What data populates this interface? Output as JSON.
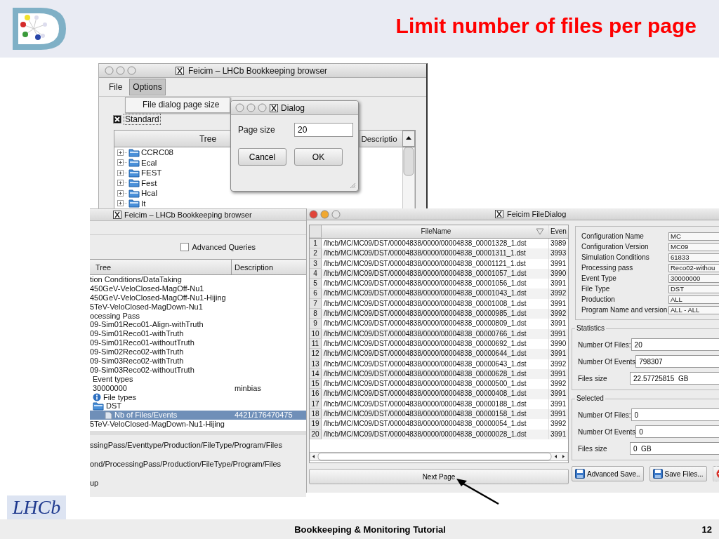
{
  "slide": {
    "title": "Limit number of files per page",
    "footer": "Bookkeeping & Monitoring Tutorial",
    "page_number": "12",
    "logo_text": "LHCb"
  },
  "browser": {
    "title": "Feicim – LHCb Bookkeeping browser",
    "menus": [
      {
        "label": "File",
        "selected": false
      },
      {
        "label": "Options",
        "selected": true
      }
    ],
    "menu_items": [
      "File dialog page size"
    ],
    "standard": {
      "label": "Standard",
      "checked": true
    },
    "columns": [
      "Tree",
      "Descriptio"
    ],
    "tree": [
      {
        "label": "CCRC08",
        "expanded": false
      },
      {
        "label": "Ecal",
        "expanded": false
      },
      {
        "label": "FEST",
        "expanded": false
      },
      {
        "label": "Fest",
        "expanded": false
      },
      {
        "label": "Hcal",
        "expanded": false
      },
      {
        "label": "It",
        "expanded": false
      }
    ]
  },
  "dialog": {
    "title": "Dialog",
    "field_label": "Page size",
    "field_value": "20",
    "buttons": [
      "Cancel",
      "OK"
    ]
  },
  "browser_back": {
    "title": "Feicim – LHCb Bookkeeping browser",
    "advanced_queries": {
      "label": "Advanced Queries",
      "checked": false
    },
    "columns": [
      "Tree",
      "Description"
    ],
    "rows": [
      {
        "label": "tion Conditions/DataTaking",
        "kind": "text",
        "selected": false
      },
      {
        "label": "450GeV-VeloClosed-MagOff-Nu1",
        "kind": "text",
        "selected": false
      },
      {
        "label": "450GeV-VeloClosed-MagOff-Nu1-Hijing",
        "kind": "text",
        "selected": false
      },
      {
        "label": "5TeV-VeloClosed-MagDown-Nu1",
        "kind": "text",
        "selected": false
      },
      {
        "label": "ocessing Pass",
        "kind": "text",
        "selected": false
      },
      {
        "label": "09-Sim01Reco01-Align-withTruth",
        "kind": "text",
        "selected": false
      },
      {
        "label": "09-Sim01Reco01-withTruth",
        "kind": "text",
        "selected": false
      },
      {
        "label": "09-Sim01Reco01-withoutTruth",
        "kind": "text",
        "selected": false
      },
      {
        "label": "09-Sim02Reco02-withTruth",
        "kind": "text",
        "selected": false
      },
      {
        "label": "09-Sim03Reco02-withTruth",
        "kind": "text",
        "selected": false
      },
      {
        "label": "09-Sim03Reco02-withoutTruth",
        "kind": "text",
        "selected": false
      },
      {
        "label": "Event types",
        "kind": "sub",
        "selected": false
      },
      {
        "label": "30000000",
        "description": "minbias",
        "kind": "sub",
        "selected": false
      },
      {
        "label": "File types",
        "kind": "info",
        "selected": false
      },
      {
        "label": "DST",
        "kind": "folder",
        "selected": false
      },
      {
        "label": "Nb of Files/Events",
        "description": "4421/176470475",
        "kind": "file",
        "selected": true
      },
      {
        "label": "5TeV-VeloClosed-MagDown-Nu1-Hijing",
        "kind": "text",
        "selected": false
      }
    ],
    "paths": [
      "ssingPass/Eventtype/Production/FileType/Program/Files",
      "ond/ProcessingPass/Production/FileType/Program/Files",
      "up"
    ]
  },
  "file_dialog": {
    "title": "Feicim FileDialog",
    "columns": [
      "FileName",
      "Even"
    ],
    "rows": [
      {
        "number": "1",
        "file": "/lhcb/MC/MC09/DST/00004838/0000/00004838_00001328_1.dst",
        "events": "3989"
      },
      {
        "number": "2",
        "file": "/lhcb/MC/MC09/DST/00004838/0000/00004838_00001311_1.dst",
        "events": "3993"
      },
      {
        "number": "3",
        "file": "/lhcb/MC/MC09/DST/00004838/0000/00004838_00001121_1.dst",
        "events": "3991"
      },
      {
        "number": "4",
        "file": "/lhcb/MC/MC09/DST/00004838/0000/00004838_00001057_1.dst",
        "events": "3990"
      },
      {
        "number": "5",
        "file": "/lhcb/MC/MC09/DST/00004838/0000/00004838_00001056_1.dst",
        "events": "3991"
      },
      {
        "number": "6",
        "file": "/lhcb/MC/MC09/DST/00004838/0000/00004838_00001043_1.dst",
        "events": "3992"
      },
      {
        "number": "7",
        "file": "/lhcb/MC/MC09/DST/00004838/0000/00004838_00001008_1.dst",
        "events": "3991"
      },
      {
        "number": "8",
        "file": "/lhcb/MC/MC09/DST/00004838/0000/00004838_00000985_1.dst",
        "events": "3992"
      },
      {
        "number": "9",
        "file": "/lhcb/MC/MC09/DST/00004838/0000/00004838_00000809_1.dst",
        "events": "3991"
      },
      {
        "number": "10",
        "file": "/lhcb/MC/MC09/DST/00004838/0000/00004838_00000766_1.dst",
        "events": "3991"
      },
      {
        "number": "11",
        "file": "/lhcb/MC/MC09/DST/00004838/0000/00004838_00000692_1.dst",
        "events": "3990"
      },
      {
        "number": "12",
        "file": "/lhcb/MC/MC09/DST/00004838/0000/00004838_00000644_1.dst",
        "events": "3991"
      },
      {
        "number": "13",
        "file": "/lhcb/MC/MC09/DST/00004838/0000/00004838_00000643_1.dst",
        "events": "3992"
      },
      {
        "number": "14",
        "file": "/lhcb/MC/MC09/DST/00004838/0000/00004838_00000628_1.dst",
        "events": "3991"
      },
      {
        "number": "15",
        "file": "/lhcb/MC/MC09/DST/00004838/0000/00004838_00000500_1.dst",
        "events": "3992"
      },
      {
        "number": "16",
        "file": "/lhcb/MC/MC09/DST/00004838/0000/00004838_00000408_1.dst",
        "events": "3991"
      },
      {
        "number": "17",
        "file": "/lhcb/MC/MC09/DST/00004838/0000/00004838_00000188_1.dst",
        "events": "3991"
      },
      {
        "number": "18",
        "file": "/lhcb/MC/MC09/DST/00004838/0000/00004838_00000158_1.dst",
        "events": "3991"
      },
      {
        "number": "19",
        "file": "/lhcb/MC/MC09/DST/00004838/0000/00004838_00000054_1.dst",
        "events": "3992"
      },
      {
        "number": "20",
        "file": "/lhcb/MC/MC09/DST/00004838/0000/00004838_00000028_1.dst",
        "events": "3991"
      }
    ],
    "next_button": "Next Page",
    "config": [
      {
        "label": "Configuration Name",
        "value": "MC"
      },
      {
        "label": "Configuration Version",
        "value": "MC09"
      },
      {
        "label": "Simulation Conditions",
        "value": "61833"
      },
      {
        "label": "Processing pass",
        "value": "Reco02-withou"
      },
      {
        "label": "Event Type",
        "value": "30000000"
      },
      {
        "label": "File Type",
        "value": "DST"
      },
      {
        "label": "Production",
        "value": "ALL"
      },
      {
        "label": "Program Name and version",
        "value": "ALL - ALL"
      }
    ],
    "groups": [
      {
        "title": "Statistics",
        "fields": [
          {
            "label": "Number Of Files:",
            "value": "20"
          },
          {
            "label": "Number Of Events",
            "value": "798307"
          },
          {
            "label": "Files size",
            "value": "22.57725815  GB"
          }
        ]
      },
      {
        "title": "Selected",
        "fields": [
          {
            "label": "Number Of Files:",
            "value": "0"
          },
          {
            "label": "Number Of Events",
            "value": "0"
          },
          {
            "label": "Files size",
            "value": "0  GB"
          }
        ]
      }
    ],
    "buttons": [
      "Advanced Save..",
      "Save Files..."
    ]
  }
}
